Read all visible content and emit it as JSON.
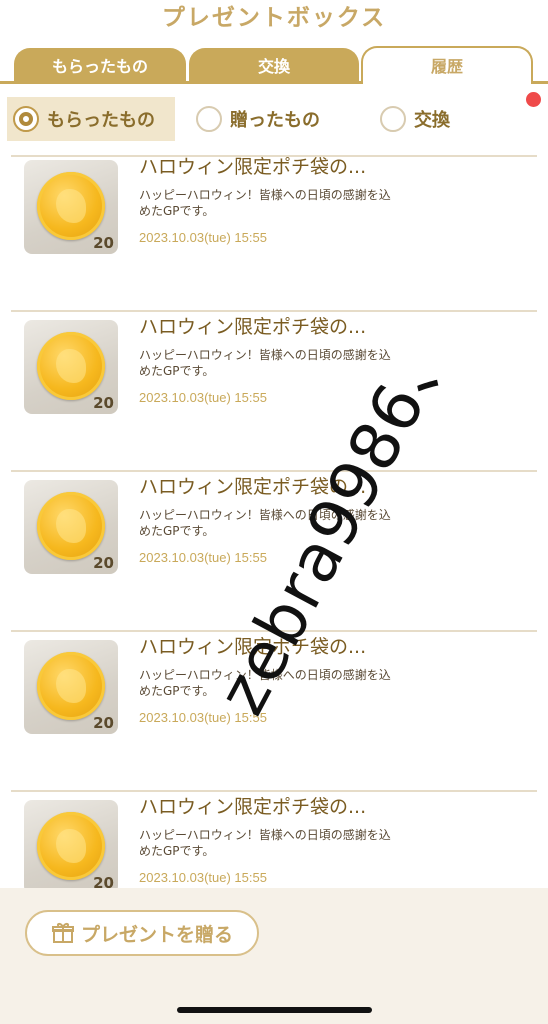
{
  "header": {
    "title": "プレゼントボックス"
  },
  "tabs": [
    {
      "label": "もらったもの",
      "state": "inactive"
    },
    {
      "label": "交換",
      "state": "inactive"
    },
    {
      "label": "履歴",
      "state": "active"
    }
  ],
  "filters": [
    {
      "label": "もらったもの",
      "selected": true
    },
    {
      "label": "贈ったもの",
      "selected": false
    },
    {
      "label": "交換",
      "selected": false
    }
  ],
  "items": [
    {
      "title": "ハロウィン限定ポチ袋の...",
      "desc": "ハッピーハロウィン！皆様への日頃の感謝を込めたGPです。",
      "date": "2023.10.03(tue) 15:55",
      "count": "20"
    },
    {
      "title": "ハロウィン限定ポチ袋の...",
      "desc": "ハッピーハロウィン！皆様への日頃の感謝を込めたGPです。",
      "date": "2023.10.03(tue) 15:55",
      "count": "20"
    },
    {
      "title": "ハロウィン限定ポチ袋の...",
      "desc": "ハッピーハロウィン！皆様への日頃の感謝を込めたGPです。",
      "date": "2023.10.03(tue) 15:55",
      "count": "20"
    },
    {
      "title": "ハロウィン限定ポチ袋の...",
      "desc": "ハッピーハロウィン！皆様への日頃の感謝を込めたGPです。",
      "date": "2023.10.03(tue) 15:55",
      "count": "20"
    },
    {
      "title": "ハロウィン限定ポチ袋の...",
      "desc": "ハッピーハロウィン！皆様への日頃の感謝を込めたGPです。",
      "date": "2023.10.03(tue) 15:55",
      "count": "20"
    }
  ],
  "footer": {
    "gift_button_label": "プレゼントを贈る",
    "gift_icon": "gift-icon"
  },
  "watermark": {
    "text": "zebra9986、"
  },
  "colors": {
    "accent_gold": "#c9a95a",
    "title_gold": "#c8a866",
    "text_brown": "#7a5c22",
    "notification_red": "#ef4a4a"
  }
}
